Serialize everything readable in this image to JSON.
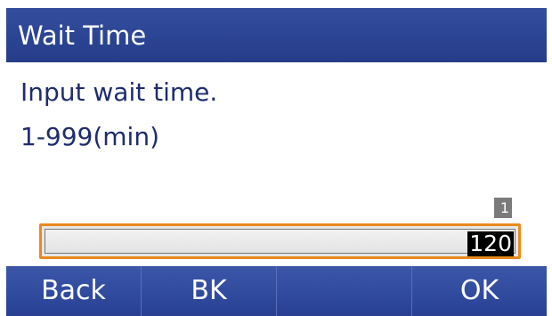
{
  "header": {
    "title": "Wait Time"
  },
  "prompt": {
    "line1": "Input wait time.",
    "line2": "1-999(min)"
  },
  "input": {
    "page_indicator": "1",
    "value": "120"
  },
  "softkeys": [
    {
      "label": "Back"
    },
    {
      "label": "BK"
    },
    {
      "label": ""
    },
    {
      "label": "OK"
    }
  ],
  "colors": {
    "header_bg": "#2c4594",
    "softkey_bg": "#304b9f",
    "text_primary": "#1f2c6d",
    "input_border": "#e98a1b",
    "badge_bg": "#7b7b7b"
  }
}
